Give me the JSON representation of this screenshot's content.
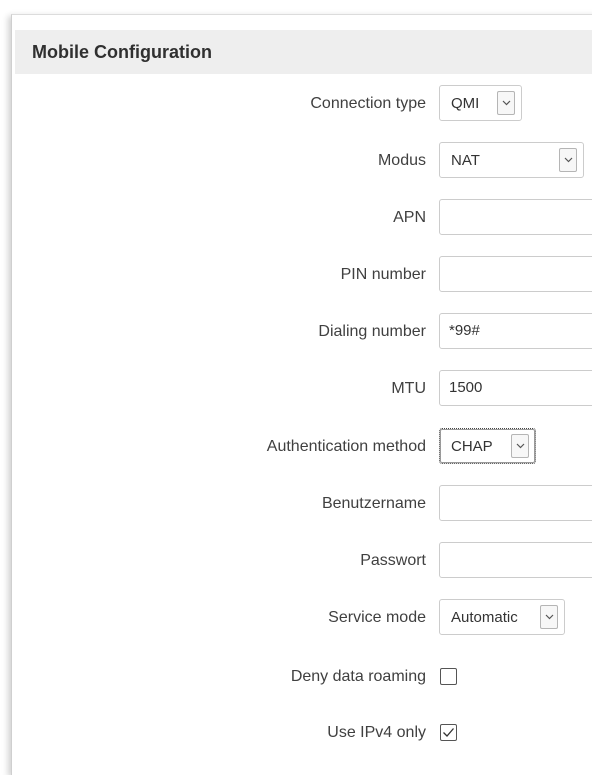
{
  "panel": {
    "title": "Mobile Configuration"
  },
  "fields": {
    "connection_type": {
      "label": "Connection type",
      "value": "QMI"
    },
    "modus": {
      "label": "Modus",
      "value": "NAT"
    },
    "apn": {
      "label": "APN",
      "value": ""
    },
    "pin_number": {
      "label": "PIN number",
      "value": ""
    },
    "dialing_number": {
      "label": "Dialing number",
      "value": "*99#"
    },
    "mtu": {
      "label": "MTU",
      "value": "1500"
    },
    "auth_method": {
      "label": "Authentication method",
      "value": "CHAP"
    },
    "username": {
      "label": "Benutzername",
      "value": ""
    },
    "password": {
      "label": "Passwort",
      "value": ""
    },
    "service_mode": {
      "label": "Service mode",
      "value": "Automatic"
    },
    "deny_roaming": {
      "label": "Deny data roaming",
      "checked": false
    },
    "ipv4_only": {
      "label": "Use IPv4 only",
      "checked": true
    }
  },
  "icons": {
    "dropdown": "chevron-down-icon",
    "check": "checkmark-icon"
  }
}
